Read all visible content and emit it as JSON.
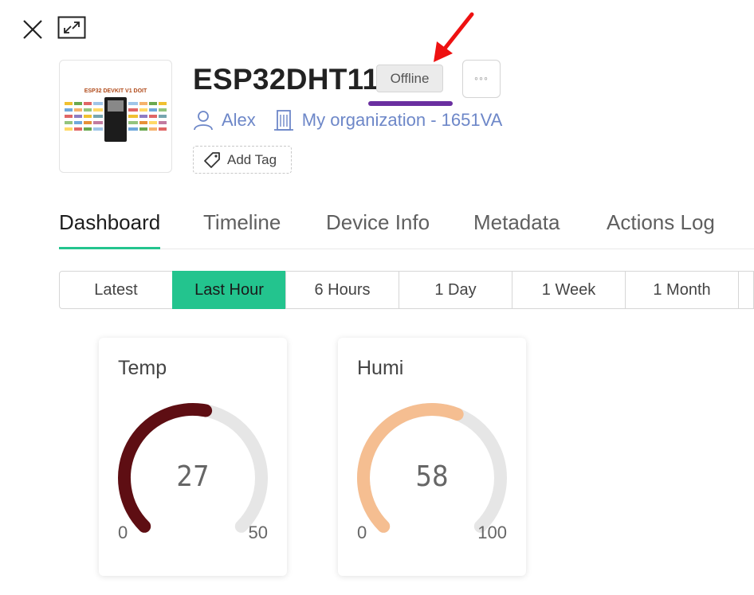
{
  "device": {
    "name": "ESP32DHT11",
    "status": "Offline",
    "owner": "Alex",
    "organization": "My organization - 1651VA",
    "add_tag_label": "Add Tag",
    "more_label": "◦◦◦",
    "thumbnail_caption": "ESP32 DEVKIT V1 DOIT"
  },
  "tabs": [
    {
      "label": "Dashboard",
      "active": true
    },
    {
      "label": "Timeline",
      "active": false
    },
    {
      "label": "Device Info",
      "active": false
    },
    {
      "label": "Metadata",
      "active": false
    },
    {
      "label": "Actions Log",
      "active": false
    }
  ],
  "time_ranges": [
    {
      "label": "Latest",
      "active": false
    },
    {
      "label": "Last Hour",
      "active": true
    },
    {
      "label": "6 Hours",
      "active": false
    },
    {
      "label": "1 Day",
      "active": false
    },
    {
      "label": "1 Week",
      "active": false
    },
    {
      "label": "1 Month",
      "active": false
    }
  ],
  "widgets": [
    {
      "title": "Temp",
      "value": "27",
      "min": "0",
      "max": "50",
      "fraction": 0.54,
      "color": "#5e0e13"
    },
    {
      "title": "Humi",
      "value": "58",
      "min": "0",
      "max": "100",
      "fraction": 0.58,
      "color": "#f5be91"
    }
  ],
  "colors": {
    "accent": "#23c48e",
    "link": "#6d87c8",
    "annotation_arrow": "#ee1111",
    "annotation_underline": "#6a2fa0",
    "gauge_track": "#e6e6e6"
  }
}
